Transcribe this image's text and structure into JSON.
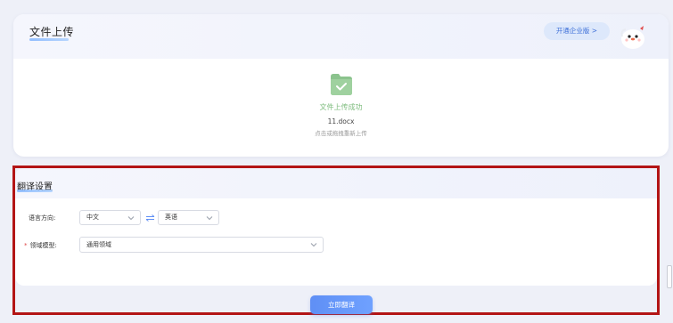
{
  "upload": {
    "title": "文件上传",
    "enterprise_button": "开通企业版 >",
    "status": "文件上传成功",
    "file_name": "11.docx",
    "reupload_hint": "点击或拖拽重新上传"
  },
  "settings": {
    "title": "翻译设置",
    "language_label": "语言方向:",
    "source_language": "中文",
    "target_language": "英语",
    "domain_label": "领域模型:",
    "domain_required": "*",
    "domain_value": "通用领域"
  },
  "actions": {
    "translate_button": "立即翻译"
  },
  "colors": {
    "accent": "#5f8ff5",
    "success": "#7fbd7f",
    "highlight_frame": "#b31515"
  }
}
